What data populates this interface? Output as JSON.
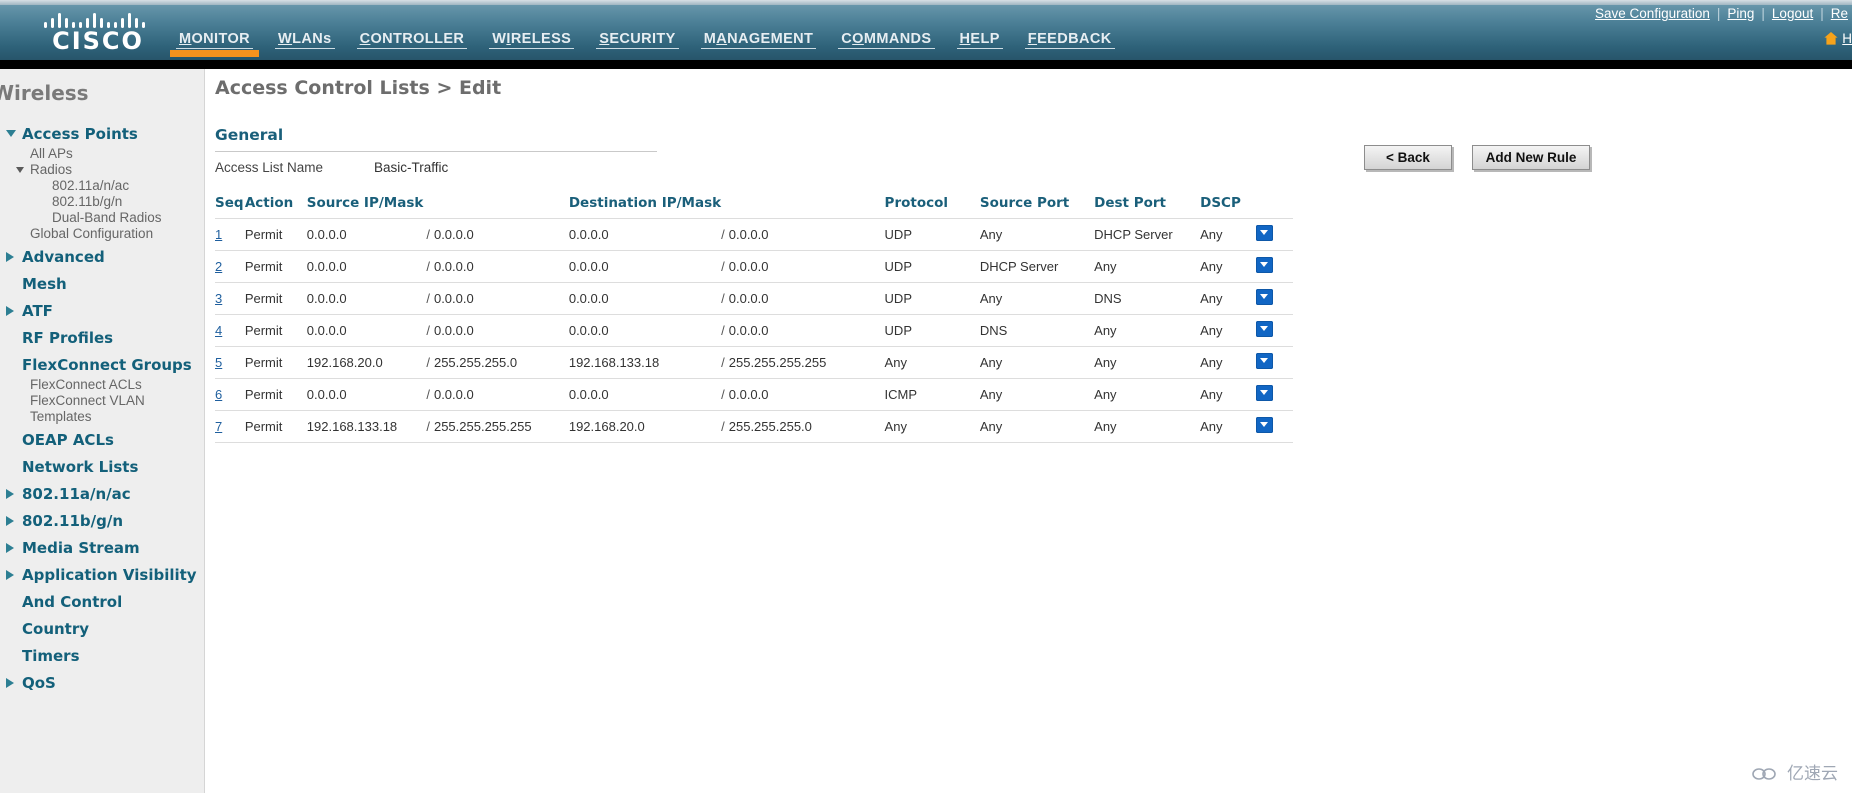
{
  "banner": {
    "logo_text": "CISCO",
    "logo_icon": "cisco-bridge-logo",
    "nav": [
      {
        "label": "MONITOR",
        "accel": "M",
        "active": true
      },
      {
        "label": "WLANs",
        "accel": "W",
        "active": false
      },
      {
        "label": "CONTROLLER",
        "accel": "C",
        "active": false
      },
      {
        "label": "WIRELESS",
        "accel": "I",
        "active": false
      },
      {
        "label": "SECURITY",
        "accel": "S",
        "active": false
      },
      {
        "label": "MANAGEMENT",
        "accel": "A",
        "active": false
      },
      {
        "label": "COMMANDS",
        "accel": "O",
        "active": false
      },
      {
        "label": "HELP",
        "accel": "H",
        "active": false
      },
      {
        "label": "FEEDBACK",
        "accel": "F",
        "active": false
      }
    ],
    "top_links": [
      {
        "label": "Save Configuration"
      },
      {
        "label": "Ping"
      },
      {
        "label": "Logout"
      },
      {
        "label": "Re"
      }
    ],
    "separator": "|",
    "home_link": "H",
    "home_icon": "home-icon",
    "accent_color": "#f6921e"
  },
  "sidebar": {
    "title": "Wireless",
    "items": [
      {
        "label": "Access Points",
        "type": "group",
        "arrow": "down"
      },
      {
        "label": "All APs",
        "type": "child",
        "indent": 1
      },
      {
        "label": "Radios",
        "type": "child",
        "indent": 1,
        "arrow": "down-small"
      },
      {
        "label": "802.11a/n/ac",
        "type": "child",
        "indent": 2
      },
      {
        "label": "802.11b/g/n",
        "type": "child",
        "indent": 2
      },
      {
        "label": "Dual-Band Radios",
        "type": "child",
        "indent": 2
      },
      {
        "label": "Global Configuration",
        "type": "child",
        "indent": 1
      },
      {
        "label": "Advanced",
        "type": "group",
        "arrow": "right"
      },
      {
        "label": "Mesh",
        "type": "group",
        "arrow": "none"
      },
      {
        "label": "ATF",
        "type": "group",
        "arrow": "right"
      },
      {
        "label": "RF Profiles",
        "type": "group",
        "arrow": "none"
      },
      {
        "label": "FlexConnect Groups",
        "type": "group",
        "arrow": "none"
      },
      {
        "label": "FlexConnect ACLs",
        "type": "child",
        "indent": 1
      },
      {
        "label": "FlexConnect VLAN",
        "type": "child",
        "indent": 1
      },
      {
        "label": "Templates",
        "type": "child",
        "indent": 1
      },
      {
        "label": "OEAP ACLs",
        "type": "group",
        "arrow": "none"
      },
      {
        "label": "Network Lists",
        "type": "group",
        "arrow": "none"
      },
      {
        "label": "802.11a/n/ac",
        "type": "group",
        "arrow": "right"
      },
      {
        "label": "802.11b/g/n",
        "type": "group",
        "arrow": "right"
      },
      {
        "label": "Media Stream",
        "type": "group",
        "arrow": "right"
      },
      {
        "label": "Application Visibility",
        "type": "group",
        "arrow": "right"
      },
      {
        "label": "And Control",
        "type": "group",
        "arrow": "none"
      },
      {
        "label": "Country",
        "type": "group",
        "arrow": "none"
      },
      {
        "label": "Timers",
        "type": "group",
        "arrow": "none"
      },
      {
        "label": "QoS",
        "type": "group",
        "arrow": "right"
      }
    ]
  },
  "main": {
    "page_title": "Access Control Lists > Edit",
    "back_button": "< Back",
    "add_new_rule_button": "Add New Rule",
    "section_title": "General",
    "acl_name_label": "Access List Name",
    "acl_name_value": "Basic-Traffic",
    "table": {
      "columns": [
        "Seq",
        "Action",
        "Source IP/Mask",
        "Destination IP/Mask",
        "Protocol",
        "Source Port",
        "Dest Port",
        "DSCP"
      ],
      "rows": [
        {
          "seq": "1",
          "action": "Permit",
          "source_ip": "0.0.0.0",
          "source_mask": "0.0.0.0",
          "dest_ip": "0.0.0.0",
          "dest_mask": "0.0.0.0",
          "protocol": "UDP",
          "source_port": "Any",
          "dest_port": "DHCP Server",
          "dscp": "Any",
          "menu_icon": "chevron-down-icon"
        },
        {
          "seq": "2",
          "action": "Permit",
          "source_ip": "0.0.0.0",
          "source_mask": "0.0.0.0",
          "dest_ip": "0.0.0.0",
          "dest_mask": "0.0.0.0",
          "protocol": "UDP",
          "source_port": "DHCP Server",
          "dest_port": "Any",
          "dscp": "Any",
          "menu_icon": "chevron-down-icon"
        },
        {
          "seq": "3",
          "action": "Permit",
          "source_ip": "0.0.0.0",
          "source_mask": "0.0.0.0",
          "dest_ip": "0.0.0.0",
          "dest_mask": "0.0.0.0",
          "protocol": "UDP",
          "source_port": "Any",
          "dest_port": "DNS",
          "dscp": "Any",
          "menu_icon": "chevron-down-icon"
        },
        {
          "seq": "4",
          "action": "Permit",
          "source_ip": "0.0.0.0",
          "source_mask": "0.0.0.0",
          "dest_ip": "0.0.0.0",
          "dest_mask": "0.0.0.0",
          "protocol": "UDP",
          "source_port": "DNS",
          "dest_port": "Any",
          "dscp": "Any",
          "menu_icon": "chevron-down-icon"
        },
        {
          "seq": "5",
          "action": "Permit",
          "source_ip": "192.168.20.0",
          "source_mask": "255.255.255.0",
          "dest_ip": "192.168.133.18",
          "dest_mask": "255.255.255.255",
          "protocol": "Any",
          "source_port": "Any",
          "dest_port": "Any",
          "dscp": "Any",
          "menu_icon": "chevron-down-icon"
        },
        {
          "seq": "6",
          "action": "Permit",
          "source_ip": "0.0.0.0",
          "source_mask": "0.0.0.0",
          "dest_ip": "0.0.0.0",
          "dest_mask": "0.0.0.0",
          "protocol": "ICMP",
          "source_port": "Any",
          "dest_port": "Any",
          "dscp": "Any",
          "menu_icon": "chevron-down-icon"
        },
        {
          "seq": "7",
          "action": "Permit",
          "source_ip": "192.168.133.18",
          "source_mask": "255.255.255.255",
          "dest_ip": "192.168.20.0",
          "dest_mask": "255.255.255.0",
          "protocol": "Any",
          "source_port": "Any",
          "dest_port": "Any",
          "dscp": "Any",
          "menu_icon": "chevron-down-icon"
        }
      ],
      "mask_separator": "/"
    }
  },
  "watermark": {
    "text": "亿速云",
    "icon": "cloud-icon"
  }
}
